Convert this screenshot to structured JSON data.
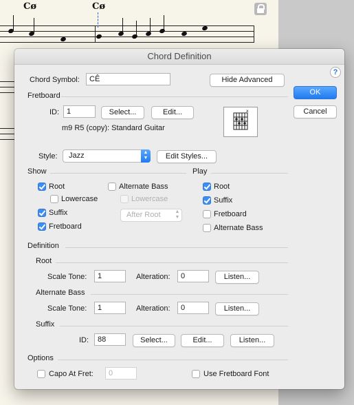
{
  "score": {
    "chords": [
      "Cø",
      "Cø"
    ]
  },
  "dialog": {
    "title": "Chord Definition",
    "help_symbol": "?",
    "chord_symbol": {
      "label": "Chord Symbol:",
      "value": "CÊ"
    },
    "hide_advanced_label": "Hide Advanced",
    "ok_label": "OK",
    "cancel_label": "Cancel",
    "fretboard": {
      "heading": "Fretboard",
      "id_label": "ID:",
      "id_value": "1",
      "select_label": "Select...",
      "edit_label": "Edit...",
      "description": "m9 R5 (copy): Standard Guitar"
    },
    "style": {
      "label": "Style:",
      "value": "Jazz",
      "edit_styles_label": "Edit Styles..."
    },
    "show": {
      "heading": "Show",
      "root": "Root",
      "lowercase": "Lowercase",
      "suffix": "Suffix",
      "fretboard": "Fretboard",
      "alternate_bass": "Alternate Bass",
      "alt_lowercase": "Lowercase",
      "position_value": "After Root"
    },
    "play": {
      "heading": "Play",
      "root": "Root",
      "suffix": "Suffix",
      "fretboard": "Fretboard",
      "alternate_bass": "Alternate Bass"
    },
    "definition": {
      "heading": "Definition",
      "root": {
        "heading": "Root",
        "scale_tone_label": "Scale Tone:",
        "scale_tone_value": "1",
        "alteration_label": "Alteration:",
        "alteration_value": "0",
        "listen_label": "Listen..."
      },
      "alternate_bass": {
        "heading": "Alternate Bass",
        "scale_tone_label": "Scale Tone:",
        "scale_tone_value": "1",
        "alteration_label": "Alteration:",
        "alteration_value": "0",
        "listen_label": "Listen..."
      },
      "suffix": {
        "heading": "Suffix",
        "id_label": "ID:",
        "id_value": "88",
        "select_label": "Select...",
        "edit_label": "Edit...",
        "listen_label": "Listen..."
      }
    },
    "options": {
      "heading": "Options",
      "capo_label": "Capo At Fret:",
      "capo_value": "0",
      "use_fretboard_font_label": "Use Fretboard Font"
    }
  }
}
